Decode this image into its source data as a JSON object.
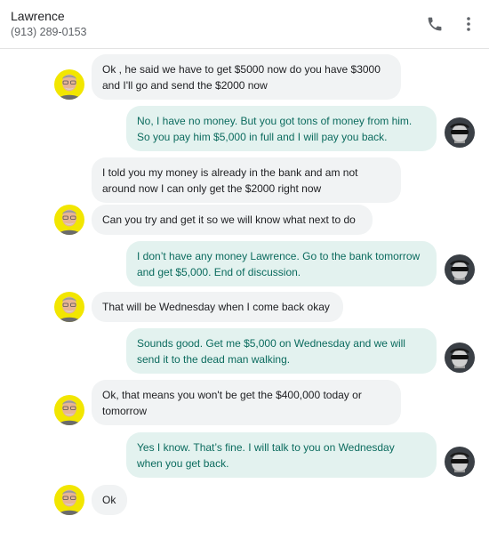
{
  "contact": {
    "name": "Lawrence",
    "phone": "(913) 289-0153"
  },
  "header_icons": {
    "call": "phone-icon",
    "menu": "more-vert-icon"
  },
  "colors": {
    "incoming_bubble": "#f1f3f4",
    "outgoing_bubble": "#e3f2ef",
    "outgoing_text": "#0b6b5e",
    "incoming_avatar_bg": "#f2e600"
  },
  "messages": [
    {
      "from": "contact",
      "lines": [
        "Ok , he said we have to get $5000 now do you have $3000",
        "and I'll go and send the $2000 now"
      ]
    },
    {
      "from": "me",
      "lines": [
        "No, I have no money. But you got tons of money from him.",
        "So you pay him $5,000 in full and I will pay you back."
      ]
    },
    {
      "from": "contact",
      "lines": [
        "I told you my money is already in the bank and am not",
        "around now I can only get the $2000 right now"
      ]
    },
    {
      "from": "contact",
      "lines": [
        "Can you try and get it so we will know what next to do"
      ]
    },
    {
      "from": "me",
      "lines": [
        "I don’t have any money Lawrence. Go to the bank tomorrow",
        "and get $5,000. End of discussion."
      ]
    },
    {
      "from": "contact",
      "lines": [
        "That will be Wednesday when I come back okay"
      ]
    },
    {
      "from": "me",
      "lines": [
        "Sounds good. Get me $5,000 on Wednesday and we will",
        "send it to the dead man walking."
      ]
    },
    {
      "from": "contact",
      "lines": [
        "Ok, that means you won't be get the $400,000 today or",
        "tomorrow"
      ]
    },
    {
      "from": "me",
      "lines": [
        "Yes I know. That’s fine. I will talk to you on Wednesday",
        "when you get back."
      ]
    },
    {
      "from": "contact",
      "lines": [
        "Ok"
      ]
    }
  ]
}
